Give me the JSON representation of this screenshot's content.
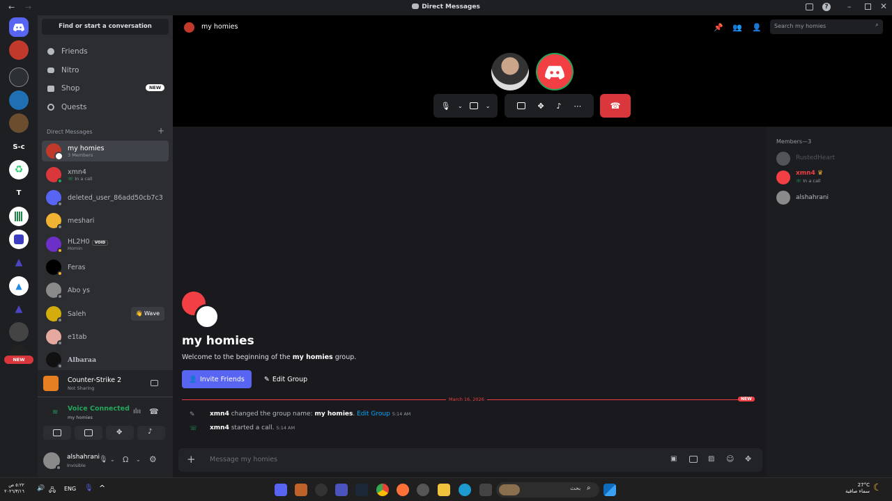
{
  "window": {
    "title": "Direct Messages"
  },
  "sidebar": {
    "search_button": "Find or start a conversation",
    "nav": [
      {
        "label": "Friends",
        "icon": "friends-icon"
      },
      {
        "label": "Nitro",
        "icon": "nitro-icon"
      },
      {
        "label": "Shop",
        "icon": "shop-icon",
        "badge": "NEW"
      },
      {
        "label": "Quests",
        "icon": "quests-icon"
      }
    ],
    "dm_header": "Direct Messages",
    "dms": [
      {
        "name": "my homies",
        "sub": "3 Members"
      },
      {
        "name": "xmn4",
        "sub": "In a call"
      },
      {
        "name": "deleted_user_86add50cb7c3",
        "sub": ""
      },
      {
        "name": "meshari",
        "sub": ""
      },
      {
        "name": "HL2H0",
        "sub": "Homin",
        "tag": "VOID"
      },
      {
        "name": "Feras",
        "sub": ""
      },
      {
        "name": "Abo ys",
        "sub": ""
      },
      {
        "name": "Saleh",
        "sub": "",
        "action": "Wave"
      },
      {
        "name": "e1tab",
        "sub": ""
      },
      {
        "name": "Albaraa",
        "sub": ""
      }
    ],
    "activity": {
      "game": "Counter-Strike 2",
      "status": "Not Sharing"
    },
    "voice": {
      "status": "Voice Connected",
      "channel": "my homies"
    },
    "user": {
      "name": "alshahrani",
      "status": "Invisible"
    }
  },
  "rail": {
    "new_badge": "NEW",
    "text_servers": [
      "S-c",
      "T"
    ]
  },
  "header": {
    "channel_name": "my homies",
    "search_placeholder": "Search my homies"
  },
  "chat": {
    "group_title": "my homies",
    "welcome_prefix": "Welcome to the beginning of the ",
    "welcome_bold": "my homies",
    "welcome_suffix": " group.",
    "invite_button": "Invite Friends",
    "edit_button": "Edit Group",
    "divider_date": "March 16, 2026",
    "divider_badge": "NEW",
    "events": [
      {
        "user": "xmn4",
        "text": " changed the group name: ",
        "bold": "my homies",
        "link": "Edit Group",
        "time": "5:14 AM"
      },
      {
        "user": "xmn4",
        "text": " started a call.",
        "bold": "",
        "link": "",
        "time": "5:14 AM"
      }
    ],
    "composer_placeholder": "Message my homies"
  },
  "members": {
    "header": "Members—3",
    "list": [
      {
        "name": "RustedHeart",
        "sub": ""
      },
      {
        "name": "xmn4",
        "sub": "In a call"
      },
      {
        "name": "alshahrani",
        "sub": ""
      }
    ]
  },
  "taskbar": {
    "time": "٥:٢٢ ص",
    "date": "٢٠٢٦/٣/١٦",
    "lang": "ENG",
    "search_text": "بحث",
    "weather_temp": "27°C",
    "weather_desc": "سماء صافية"
  },
  "colors": {
    "blurple": "#5865f2",
    "red": "#da373c",
    "green": "#23a55a",
    "pink": "#f23f43"
  }
}
